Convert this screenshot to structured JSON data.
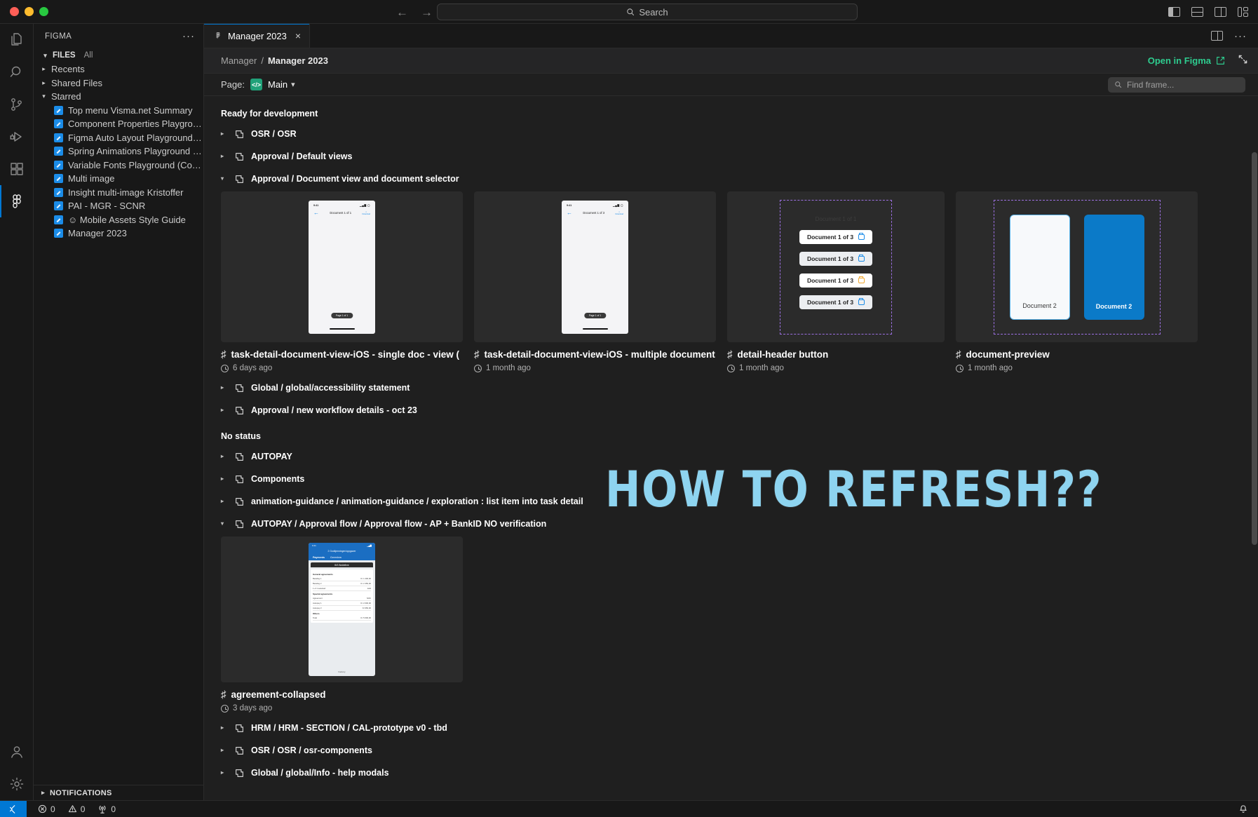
{
  "window": {
    "search_placeholder": "Search",
    "traffic_lights": [
      "close",
      "minimize",
      "zoom"
    ]
  },
  "activitybar": {
    "items": [
      {
        "name": "explorer",
        "icon": "files-icon",
        "active": false
      },
      {
        "name": "search",
        "icon": "search-icon",
        "active": false
      },
      {
        "name": "source-control",
        "icon": "source-control-icon",
        "active": false
      },
      {
        "name": "run-and-debug",
        "icon": "run-debug-icon",
        "active": false
      },
      {
        "name": "extensions",
        "icon": "extensions-icon",
        "active": false
      },
      {
        "name": "figma",
        "icon": "figma-icon",
        "active": true
      }
    ],
    "bottom": [
      {
        "name": "accounts",
        "icon": "account-icon"
      },
      {
        "name": "manage",
        "icon": "gear-icon"
      }
    ]
  },
  "sidebar": {
    "title": "FIGMA",
    "more_label": "···",
    "section": {
      "label": "FILES",
      "filter": "All"
    },
    "groups": [
      {
        "label": "Recents",
        "expanded": false
      },
      {
        "label": "Shared Files",
        "expanded": false
      },
      {
        "label": "Starred",
        "expanded": true
      }
    ],
    "files": [
      "Top menu Visma.net Summary",
      "Component Properties Playground (...",
      "Figma Auto Layout Playground (Com...",
      "Spring Animations Playground (Com...",
      "Variable Fonts Playground (Commun...",
      "Multi image",
      "Insight multi-image Kristoffer",
      "PAI - MGR - SCNR",
      "☺ Mobile Assets Style Guide",
      "Manager 2023"
    ],
    "notifications": "NOTIFICATIONS"
  },
  "editor": {
    "tab": {
      "label": "Manager 2023",
      "close": "×"
    },
    "breadcrumb": {
      "parent": "Manager",
      "separator": "/",
      "current": "Manager 2023"
    },
    "open_in_figma": "Open in Figma",
    "page": {
      "label": "Page:",
      "badge": "</>",
      "name": "Main",
      "chevron": "⌄"
    },
    "find_frame_placeholder": "Find frame..."
  },
  "canvas": {
    "sections": [
      {
        "status": "Ready for development",
        "frames": [
          {
            "label": "OSR / OSR",
            "expanded": false
          },
          {
            "label": "Approval / Default views",
            "expanded": false
          },
          {
            "label": "Approval / Document view and document selector",
            "expanded": true
          }
        ]
      }
    ],
    "cards": [
      {
        "label": "task-detail-document-view-iOS - single doc - view (",
        "time": "6 days ago",
        "preview": "phone-single-doc",
        "phone": {
          "status_time": "9:41",
          "nav_title": "Document 1 of 1",
          "download": "Download",
          "pill": "Page 1 of 1"
        }
      },
      {
        "label": "task-detail-document-view-iOS - multiple document",
        "time": "1 month ago",
        "preview": "phone-multi-doc",
        "phone": {
          "status_time": "9:41",
          "nav_title": "Document 1 of 3",
          "download": "Download",
          "pill": "Page 1 of 1"
        }
      },
      {
        "label": "detail-header button",
        "time": "1 month ago",
        "preview": "doc-buttons",
        "ghost_title": "Document 1 of 1",
        "buttons": [
          {
            "text": "Document 1 of 3",
            "style": "white",
            "folder": "blue"
          },
          {
            "text": "Document 1 of 3",
            "style": "grey",
            "folder": "blue"
          },
          {
            "text": "Document 1 of 3",
            "style": "white",
            "folder": "orange"
          },
          {
            "text": "Document 1 of 3",
            "style": "grey",
            "folder": "blue"
          }
        ]
      },
      {
        "label": "document-preview",
        "time": "1 month ago",
        "preview": "document-panes",
        "panes": [
          {
            "text": "Document 2",
            "variant": "light"
          },
          {
            "text": "Document 2",
            "variant": "blue"
          }
        ]
      }
    ],
    "frames_after_cards": [
      {
        "label": "Global / global/accessibility statement",
        "expanded": false
      },
      {
        "label": "Approval / new workflow details - oct 23",
        "expanded": false
      }
    ],
    "second_status": "No status",
    "frames_no_status": [
      {
        "label": "AUTOPAY",
        "expanded": false
      },
      {
        "label": "Components",
        "expanded": false
      },
      {
        "label": "animation-guidance / animation-guidance / exploration : list item into task detail",
        "expanded": false
      },
      {
        "label": "AUTOPAY / Approval flow / Approval flow - AP + BankID NO verification",
        "expanded": true
      }
    ],
    "agreement_card": {
      "label": "agreement-collapsed",
      "time": "3 days ago",
      "phone": {
        "status_time": "9:41",
        "top_title": "2 Godkjenninger/oppgaver",
        "tab_payments": "Payments",
        "tab_overview": "Overview",
        "card_title": "B/S Bedleflere",
        "section1": "General agreements",
        "section2": "Special agreements",
        "section3": "Others",
        "rows": [
          {
            "left": "Betaling 1",
            "right": "Kr 1 200,00"
          },
          {
            "left": "Betaling 2",
            "right": "Kr 2 450,00"
          },
          {
            "left": "1 of 1 selected",
            "right": "Edit"
          },
          {
            "left": "Agreement",
            "right": "NOK"
          },
          {
            "left": "Autopay 1",
            "right": "Kr 2 000,00"
          },
          {
            "left": "Autopay 2",
            "right": "Kr 950,00"
          },
          {
            "left": "Total",
            "right": "Kr 5 600,00"
          }
        ],
        "footer": "Factory"
      }
    },
    "frames_tail": [
      {
        "label": "HRM / HRM - SECTION / CAL-prototype v0 - tbd",
        "expanded": false
      },
      {
        "label": "OSR / OSR / osr-components",
        "expanded": false
      },
      {
        "label": "Global / global/Info - help modals",
        "expanded": false
      }
    ],
    "overlay_text": "HOW TO REFRESH??"
  },
  "statusbar": {
    "remote_icon": "remote-icon",
    "errors": "0",
    "warnings": "0",
    "ports": "0",
    "bell_icon": "bell-icon"
  },
  "colors": {
    "accent_blue": "#0078d4",
    "figma_green": "#2ecc8f",
    "overlay_blue": "#8ed4f0",
    "dashed_purple": "#9b6fe0",
    "doc_blue": "#0b7ac8"
  }
}
